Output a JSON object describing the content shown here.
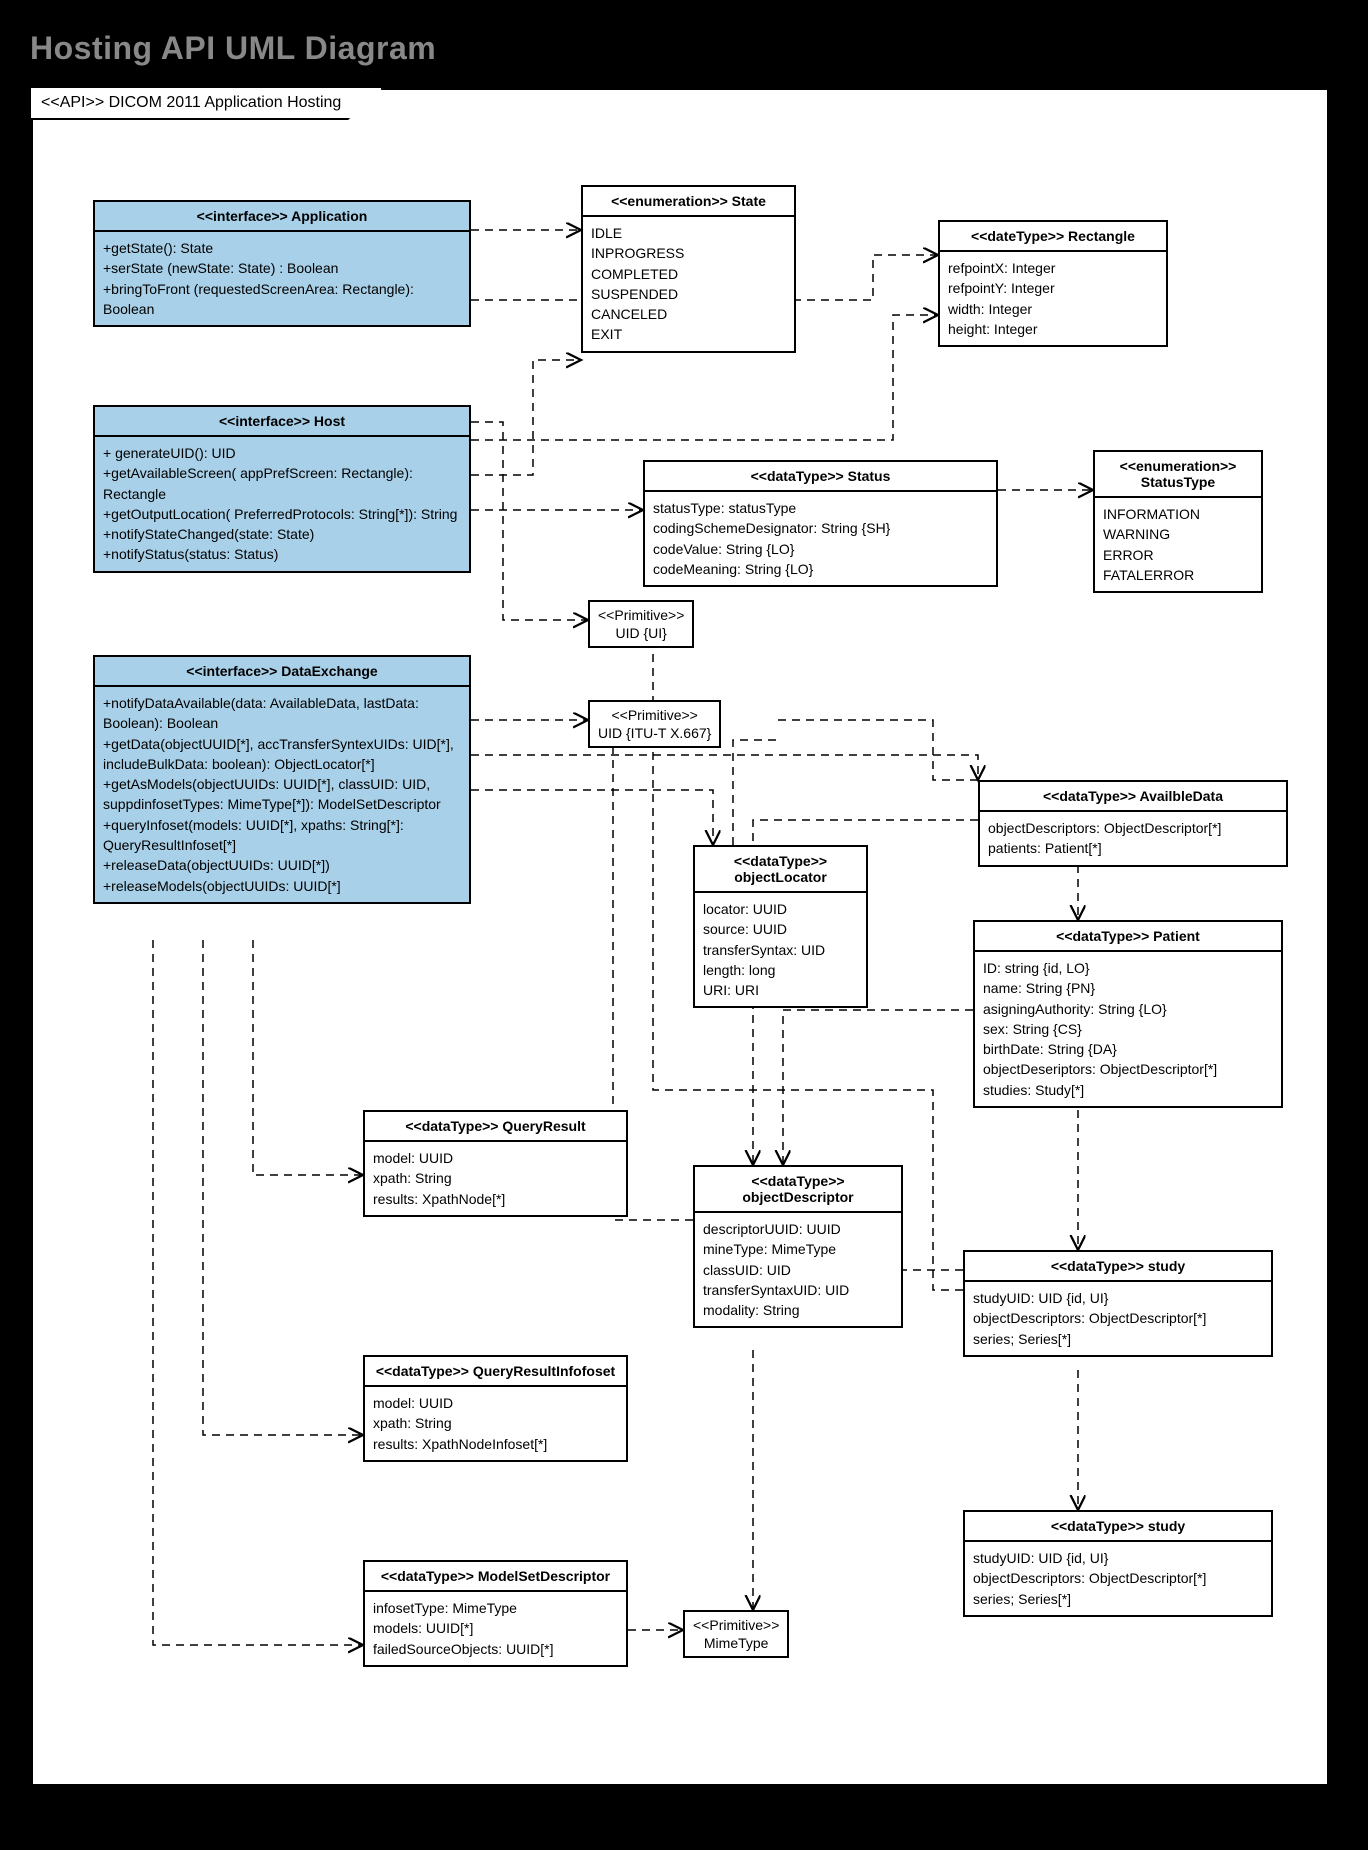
{
  "title": "Hosting API UML Diagram",
  "package_tab": "<<API>> DICOM 2011 Application Hosting",
  "boxes": {
    "application": {
      "header": "<<interface>> Application",
      "lines": [
        "+getState(): State",
        "+serState (newState: State) : Boolean",
        "+bringToFront (requestedScreenArea: Rectangle): Boolean"
      ]
    },
    "host": {
      "header": "<<interface>> Host",
      "lines": [
        "+ generateUID(): UID",
        "+getAvailableScreen( appPrefScreen: Rectangle): Rectangle",
        "+getOutputLocation( PreferredProtocols: String[*]): String",
        "+notifyStateChanged(state: State)",
        "+notifyStatus(status: Status)"
      ]
    },
    "dataexchange": {
      "header": "<<interface>> DataExchange",
      "lines": [
        "+notifyDataAvailable(data: AvailableData, lastData: Boolean): Boolean",
        "+getData(objectUUID[*], accTransferSyntexUIDs: UID[*], includeBulkData: boolean): ObjectLocator[*]",
        "+getAsModels(objectUUIDs: UUID[*], classUID: UID, suppdinfosetTypes: MimeType[*]): ModelSetDescriptor",
        "+queryInfoset(models: UUID[*], xpaths: String[*]: QueryResultInfoset[*]",
        "+releaseData(objectUUIDs: UUID[*])",
        "+releaseModels(objectUUIDs: UUID[*]"
      ]
    },
    "state": {
      "header": "<<enumeration>> State",
      "lines": [
        "IDLE",
        "INPROGRESS",
        "COMPLETED",
        "SUSPENDED",
        "CANCELED",
        "EXIT"
      ]
    },
    "rectangle": {
      "header": "<<dateType>> Rectangle",
      "lines": [
        "refpointX: Integer",
        "refpointY: Integer",
        "width: Integer",
        "height: Integer"
      ]
    },
    "status": {
      "header": "<<dataType>> Status",
      "lines": [
        "statusType: statusType",
        "codingSchemeDesignator: String {SH}",
        "codeValue: String {LO}",
        "codeMeaning: String {LO}"
      ]
    },
    "statustype": {
      "header": "<<enumeration>>\nStatusType",
      "lines": [
        "INFORMATION",
        "WARNING",
        "ERROR",
        "FATALERROR"
      ]
    },
    "uid1": "<<Primitive>>\nUID {UI}",
    "uid2": "<<Primitive>>\nUID {ITU-T X.667}",
    "objectlocator": {
      "header": "<<dataType>>\nobjectLocator",
      "lines": [
        "locator: UUID",
        "source: UUID",
        "transferSyntax: UID",
        "length: long",
        "URI: URI"
      ]
    },
    "availabledata": {
      "header": "<<dataType>> AvailbleData",
      "lines": [
        "objectDescriptors: ObjectDescriptor[*]",
        "patients: Patient[*]"
      ]
    },
    "patient": {
      "header": "<<dataType>> Patient",
      "lines": [
        "ID: string {id, LO}",
        "name: String {PN}",
        "asigningAuthority: String {LO}",
        "sex: String {CS}",
        "birthDate: String {DA}",
        "objectDeseriptors: ObjectDescriptor[*]",
        "studies: Study[*]"
      ]
    },
    "queryresult": {
      "header": "<<dataType>> QueryResult",
      "lines": [
        "model: UUID",
        "xpath: String",
        "results: XpathNode[*]"
      ]
    },
    "queryresultinfoset": {
      "header": "<<dataType>> QueryResultInfofoset",
      "lines": [
        "model: UUID",
        "xpath: String",
        "results: XpathNodeInfoset[*]"
      ]
    },
    "objectdescriptor": {
      "header": "<<dataType>>\nobjectDescriptor",
      "lines": [
        "descriptorUUID: UUID",
        "mineType: MimeType",
        "classUID: UID",
        "transferSyntaxUID: UID",
        "modality: String"
      ]
    },
    "study1": {
      "header": "<<dataType>> study",
      "lines": [
        "studyUID: UID {id, UI}",
        "objectDescriptors: ObjectDescriptor[*]",
        "series; Series[*]"
      ]
    },
    "modelsetdescriptor": {
      "header": "<<dataType>> ModelSetDescriptor",
      "lines": [
        "infosetType: MimeType",
        "models: UUID[*]",
        "failedSourceObjects: UUID[*]"
      ]
    },
    "study2": {
      "header": "<<dataType>> study",
      "lines": [
        "studyUID: UID {id, UI}",
        "objectDescriptors: ObjectDescriptor[*]",
        "series; Series[*]"
      ]
    },
    "mimetype": "<<Primitive>>\nMimeType"
  }
}
